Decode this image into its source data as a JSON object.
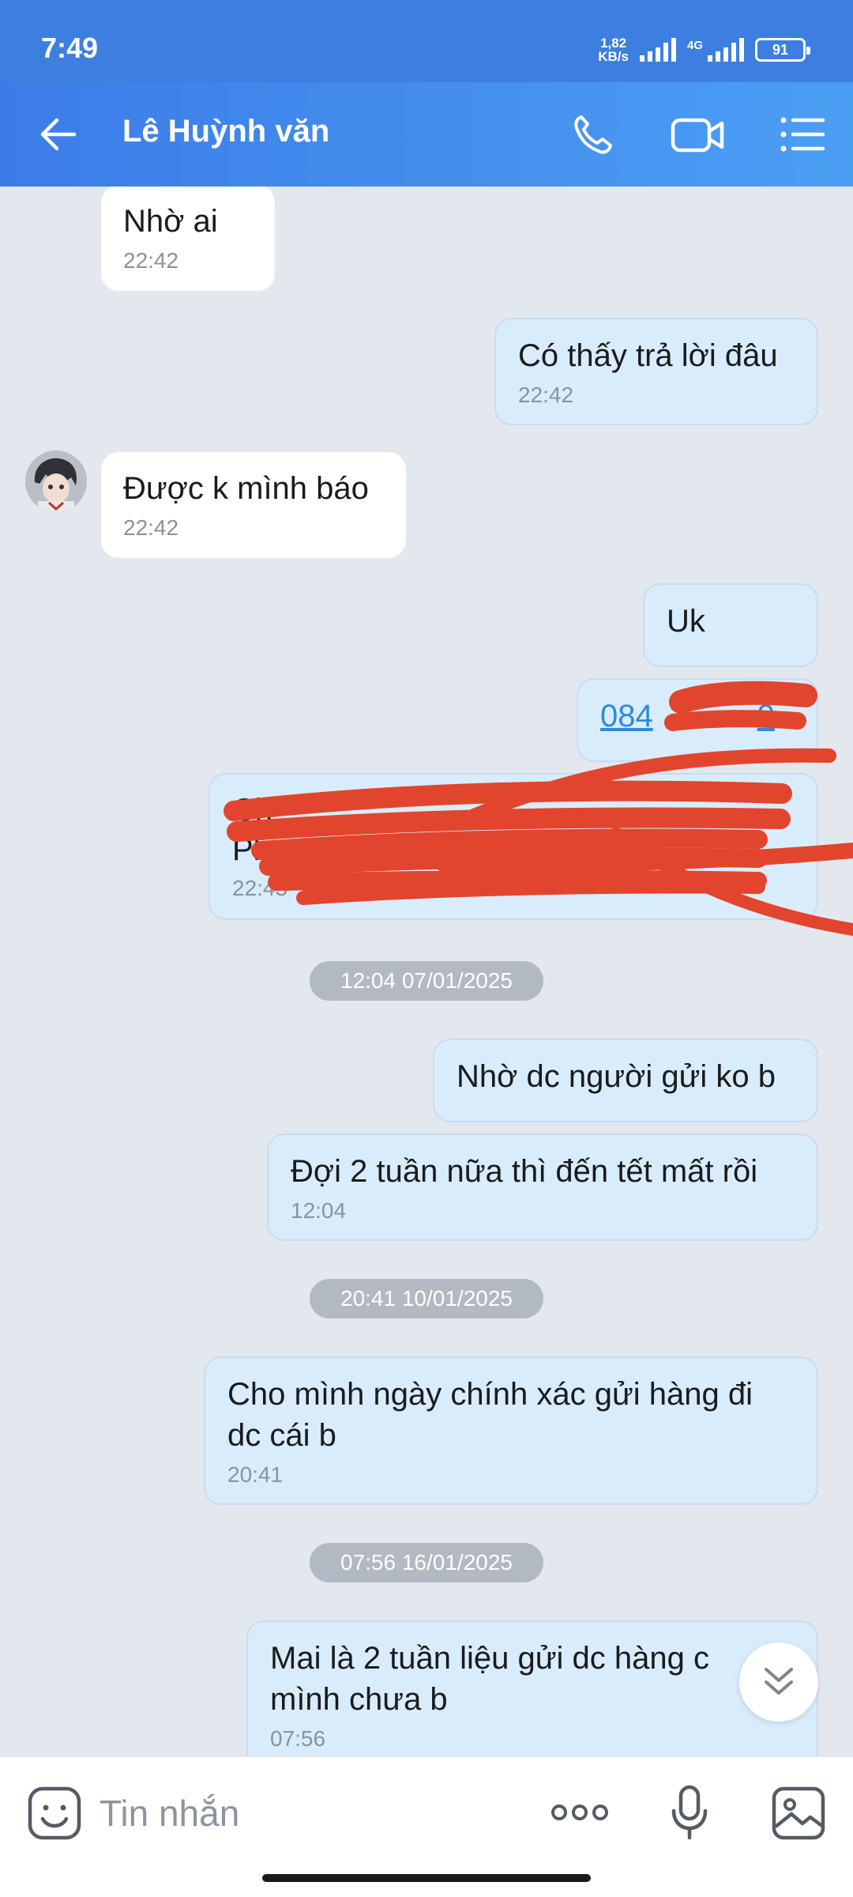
{
  "status_bar": {
    "time": "7:49",
    "net_speed_top": "1,82",
    "net_speed_unit": "KB/s",
    "network": "4G",
    "battery": "91"
  },
  "header": {
    "contact_name": "Lê Huỳnh văn"
  },
  "icons": {
    "back": "arrow-left-icon",
    "call": "phone-icon",
    "video": "video-camera-icon",
    "menu": "list-menu-icon",
    "sticker": "sticker-face-icon",
    "more": "more-dots-icon",
    "mic": "microphone-icon",
    "image": "image-icon",
    "scroll": "chevron-double-down-icon"
  },
  "messages": [
    {
      "dir": "in",
      "text": "Nhờ ai",
      "time": "22:42"
    },
    {
      "dir": "out",
      "text": "Có thấy trả lời đâu",
      "time": "22:42"
    },
    {
      "dir": "in",
      "text": "Được k mình báo",
      "time": "22:42"
    },
    {
      "dir": "out",
      "text": "Uk"
    },
    {
      "dir": "out",
      "text": "084",
      "text_tail": "9"
    },
    {
      "dir": "out",
      "text": "Ch",
      "text_line2": "Ph",
      "time": "22:43"
    },
    {
      "dir": "out",
      "text": "Nhờ dc người gửi ko b"
    },
    {
      "dir": "out",
      "text": "Đợi 2 tuần nữa thì đến tết mất rồi",
      "time": "12:04"
    },
    {
      "dir": "out",
      "text": "Cho mình ngày chính xác gửi hàng đi",
      "text_line2": "dc cái b",
      "time": "20:41"
    },
    {
      "dir": "out",
      "text": "Mai là 2 tuần liệu gửi dc hàng c",
      "text_line2": "mình chưa b",
      "time": "07:56"
    }
  ],
  "date_separators": [
    "12:04 07/01/2025",
    "20:41 10/01/2025",
    "07:56 16/01/2025"
  ],
  "composer": {
    "placeholder": "Tin nhắn"
  },
  "colors": {
    "header": "#3c7ce8",
    "chat_bg": "#e3e8ef",
    "out_bubble": "#d9ecfc",
    "in_bubble": "#ffffff",
    "redaction": "#e2452d"
  }
}
